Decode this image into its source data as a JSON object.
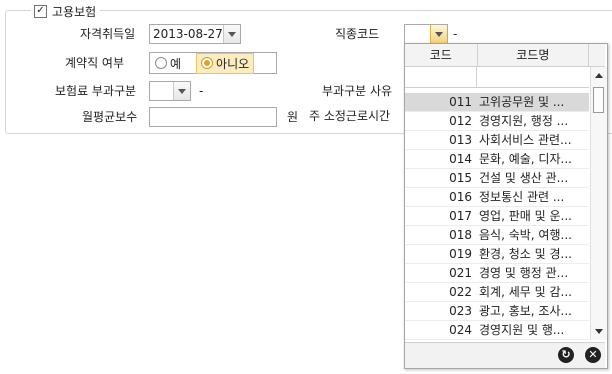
{
  "group": {
    "title": "고용보험",
    "checked": true,
    "check_glyph": "✓"
  },
  "fields": {
    "acquire_date": {
      "label": "자격취득일",
      "value": "2013-08-27"
    },
    "job_code": {
      "label": "직종코드",
      "value": "",
      "suffix": "-"
    },
    "contract": {
      "label": "계약직 여부",
      "option_yes": "예",
      "option_no": "아니오",
      "selected": "아니오"
    },
    "premium_type": {
      "label": "보험료 부과구분",
      "value": "",
      "suffix": "-"
    },
    "premium_reason": {
      "label": "부과구분 사유"
    },
    "monthly_pay": {
      "label": "월평균보수",
      "value": "",
      "unit": "원"
    },
    "weekly_hours": {
      "label": "주 소정근로시간"
    }
  },
  "popup": {
    "headers": {
      "code": "코드",
      "name": "코드명"
    },
    "rows": [
      {
        "code": "011",
        "name": "고위공무원 및 ..."
      },
      {
        "code": "012",
        "name": "경영지원, 행정 ..."
      },
      {
        "code": "013",
        "name": "사회서비스 관련..."
      },
      {
        "code": "014",
        "name": "문화, 예술, 디자..."
      },
      {
        "code": "015",
        "name": "건설 및 생산 관..."
      },
      {
        "code": "016",
        "name": "정보통신 관련 ..."
      },
      {
        "code": "017",
        "name": "영업, 판매 및 운..."
      },
      {
        "code": "018",
        "name": "음식, 숙박, 여행..."
      },
      {
        "code": "019",
        "name": "환경, 청소 및 경..."
      },
      {
        "code": "021",
        "name": "경영 및 행정 관..."
      },
      {
        "code": "022",
        "name": "회계, 세무 및 감..."
      },
      {
        "code": "023",
        "name": "광고, 홍보, 조사..."
      },
      {
        "code": "024",
        "name": "경영지원 및 행..."
      }
    ],
    "selected_index": 0,
    "refresh_glyph": "↻",
    "close_glyph": "✕"
  },
  "colors": {
    "accent": "#e6a21f",
    "selected_row": "#d9d9d9",
    "selected_radio_bg": "#fcecc0"
  }
}
